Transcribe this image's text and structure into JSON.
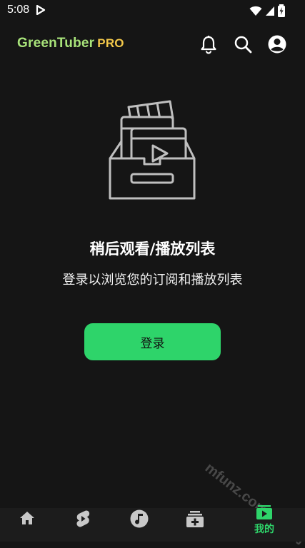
{
  "status_bar": {
    "time": "5:08"
  },
  "app_bar": {
    "logo_main": "GreenTuber",
    "logo_badge": "PRO"
  },
  "icons": {
    "notifications": "bell-icon",
    "search": "search-icon",
    "account": "account-circle-icon"
  },
  "empty_state": {
    "title": "稍后观看/播放列表",
    "subtitle": "登录以浏览您的订阅和播放列表",
    "login_label": "登录"
  },
  "bottom_nav": {
    "items": [
      {
        "icon": "home-icon",
        "label": ""
      },
      {
        "icon": "shorts-icon",
        "label": ""
      },
      {
        "icon": "music-icon",
        "label": ""
      },
      {
        "icon": "subscriptions-icon",
        "label": ""
      },
      {
        "icon": "library-icon",
        "label": "我的",
        "active": true
      }
    ]
  },
  "watermark": {
    "text": "mfunz.com 魔趣网"
  },
  "colors": {
    "accent": "#2ed46a",
    "background": "#151515",
    "logo_green": "#a8e37a",
    "logo_gold": "#f3c84a"
  }
}
